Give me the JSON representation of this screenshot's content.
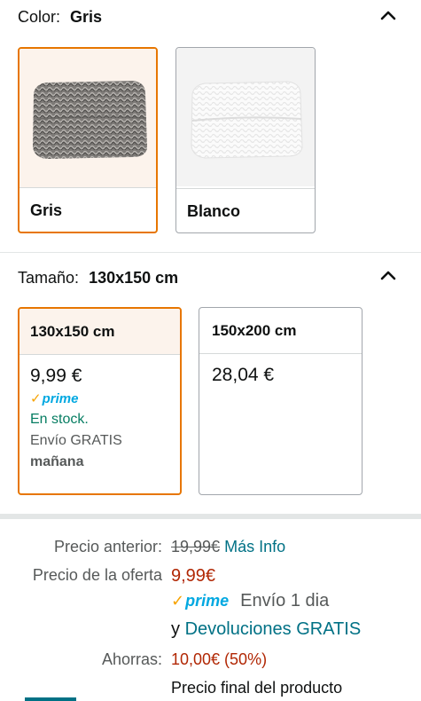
{
  "color_section": {
    "label": "Color:",
    "selected": "Gris",
    "options": [
      {
        "name": "Gris",
        "selected": true
      },
      {
        "name": "Blanco",
        "selected": false
      }
    ]
  },
  "size_section": {
    "label": "Tamaño:",
    "selected": "130x150 cm",
    "options": [
      {
        "name": "130x150 cm",
        "price": "9,99 €",
        "prime": "prime",
        "stock": "En stock.",
        "shipping": "Envío GRATIS",
        "delivery": "mañana",
        "selected": true
      },
      {
        "name": "150x200 cm",
        "price": "28,04 €",
        "selected": false
      }
    ]
  },
  "pricing": {
    "previous_label": "Precio anterior:",
    "previous_value": "19,99€",
    "more_info": "Más Info",
    "deal_label": "Precio de la oferta",
    "deal_value": "9,99€",
    "prime": "prime",
    "prime_shipping": "Envío 1 dia",
    "returns_prefix": "y",
    "returns_link": "Devoluciones GRATIS",
    "savings_label": "Ahorras:",
    "savings_value": "10,00€ (50%)",
    "final_note": "Precio final del producto"
  },
  "colors": {
    "selected_border": "#e77600",
    "link": "#007185",
    "price_red": "#b12704",
    "stock_green": "#067d62",
    "prime_blue": "#00a8e1"
  }
}
